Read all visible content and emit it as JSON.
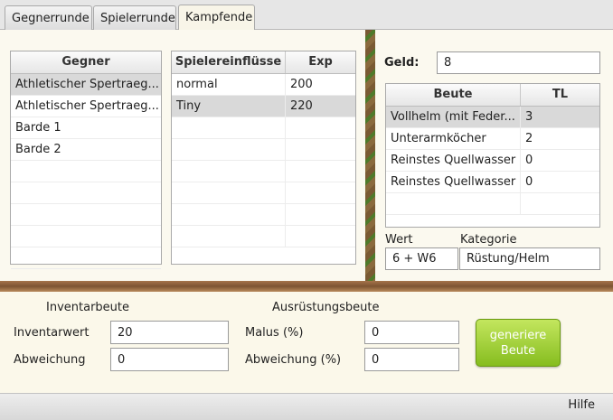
{
  "tabs": [
    "Gegnerrunde",
    "Spielerrunde",
    "Kampfende"
  ],
  "gegner": {
    "header": "Gegner",
    "rows": [
      "Athletischer Spertraeg...",
      "Athletischer Spertraeg...",
      "Barde 1",
      "Barde 2"
    ]
  },
  "einfluss": {
    "headers": [
      "Spielereinflüsse",
      "Exp"
    ],
    "rows": [
      {
        "name": "normal",
        "exp": "200"
      },
      {
        "name": "Tiny",
        "exp": "220"
      }
    ]
  },
  "geld": {
    "label": "Geld:",
    "value": "8"
  },
  "beute": {
    "headers": [
      "Beute",
      "TL"
    ],
    "rows": [
      {
        "name": "Vollhelm (mit Feder...",
        "tl": "3"
      },
      {
        "name": "Unterarmköcher",
        "tl": "2"
      },
      {
        "name": "Reinstes Quellwasser",
        "tl": "0"
      },
      {
        "name": "Reinstes Quellwasser",
        "tl": "0"
      }
    ]
  },
  "wert": {
    "label": "Wert",
    "value": "6 + W6"
  },
  "kategorie": {
    "label": "Kategorie",
    "value": "Rüstung/Helm"
  },
  "inventar": {
    "title": "Inventarbeute",
    "wert_label": "Inventarwert",
    "wert_value": "20",
    "abw_label": "Abweichung",
    "abw_value": "0"
  },
  "ausruestung": {
    "title": "Ausrüstungsbeute",
    "malus_label": "Malus (%)",
    "malus_value": "0",
    "abw_label": "Abweichung (%)",
    "abw_value": "0"
  },
  "generate_button": "generiere Beute",
  "help": "Hilfe",
  "colors": {
    "selected_row": "#d9d9d9",
    "button_green": "#9acd32",
    "wood": "#8b5e3c"
  }
}
